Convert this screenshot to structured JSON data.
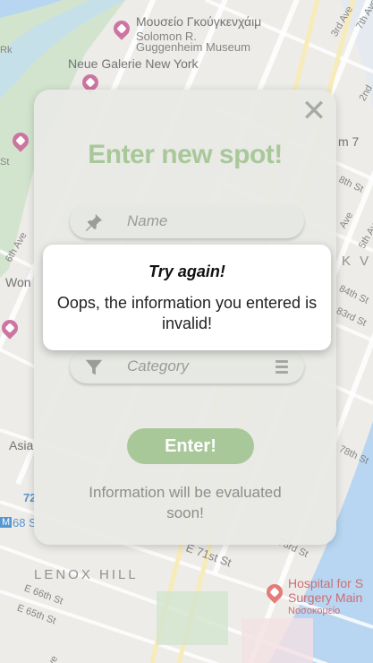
{
  "map": {
    "labels": [
      "Μουσείο Γκούγκενχάιμ",
      "Solomon R.",
      "Guggenheim Museum",
      "Neue Galerie New York",
      "LENOX HILL",
      "Hospital for S",
      "Surgery Main",
      "Νοσοκομείο",
      "E 71st St",
      "E 66th St",
      "E 65th St",
      "Asia",
      "Won",
      "3rd Ave",
      "2nd",
      "84th St",
      "83rd St",
      "78th St",
      "73rd St",
      "8th St",
      "m 7",
      "K V",
      "Ave",
      "Ave",
      "7th Ave",
      "6th Ave",
      "5th Ave",
      "St",
      "Rk",
      "72",
      "68 S",
      "M"
    ],
    "colors": {
      "land": "#e9e8e3",
      "park": "#c9dfc4",
      "water": "#a9cdee",
      "road": "#ffffff",
      "major_road": "#f6e7a8",
      "museum_pin": "#c2578c",
      "hospital_pin": "#e0605a"
    }
  },
  "modal": {
    "close_label": "✕",
    "title": "Enter new spot!",
    "name_placeholder": "Name",
    "category_placeholder": "Category",
    "name_icon": "pushpin-icon",
    "category_icon": "filter-icon",
    "menu_icon": "menu-icon",
    "submit_label": "Enter!",
    "note": "Information will be evaluated soon!",
    "colors": {
      "accent": "#a9c89a",
      "card": "#e8eae5",
      "muted_text": "#8c8e8b"
    }
  },
  "alert": {
    "title": "Try again!",
    "message": "Oops, the information you entered is invalid!"
  }
}
